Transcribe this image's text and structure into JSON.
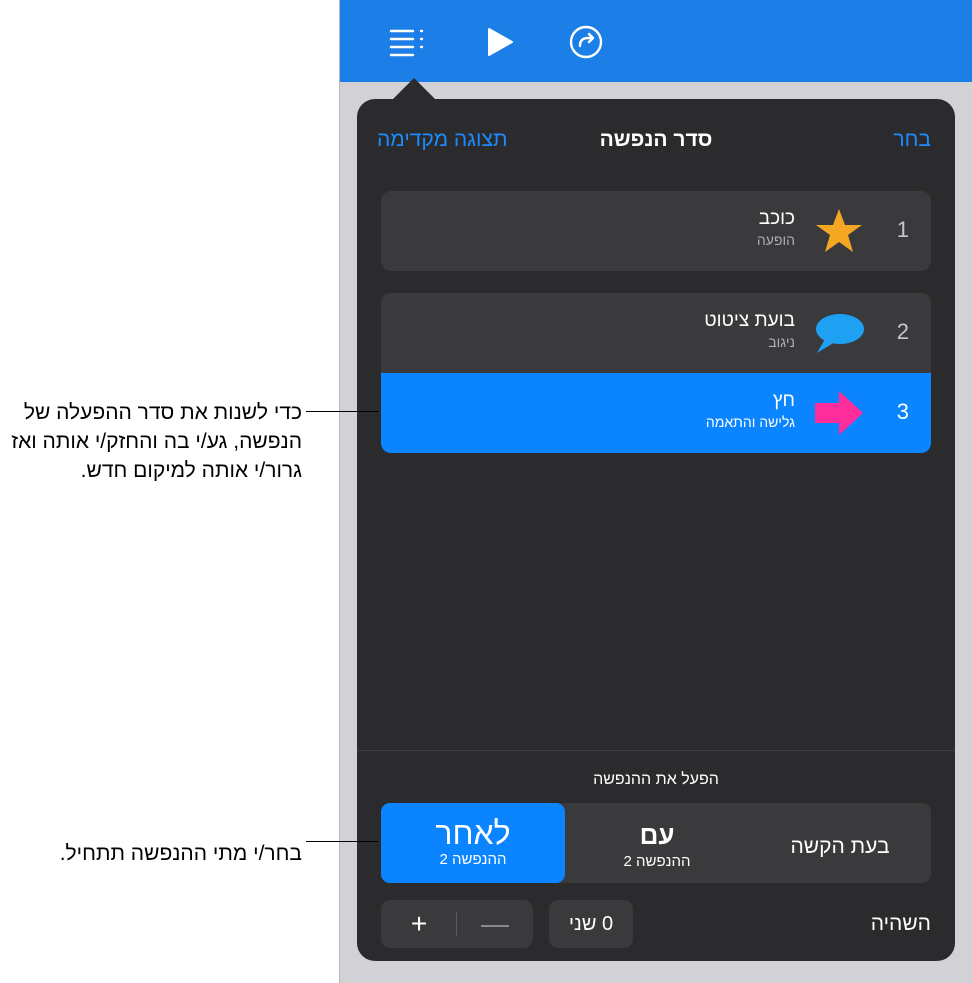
{
  "popover": {
    "title": "סדר הנפשה",
    "preview_label": "תצוגה מקדימה",
    "select_label": "בחר"
  },
  "animations": [
    {
      "number": "1",
      "name": "כוכב",
      "effect": "הופעה",
      "icon": "star-icon",
      "color": "#f5a623"
    },
    {
      "number": "2",
      "name": "בועת ציטוט",
      "effect": "ניגוב",
      "icon": "speech-bubble-icon",
      "color": "#1ea1f2"
    },
    {
      "number": "3",
      "name": "חץ",
      "effect": "גלישה והתאמה",
      "icon": "arrow-icon",
      "color": "#ff2d9b",
      "selected": true
    }
  ],
  "start": {
    "label": "הפעל את ההנפשה",
    "options": [
      {
        "main": "לאחר",
        "sub": "ההנפשה 2",
        "selected": true
      },
      {
        "main": "עם",
        "sub": "ההנפשה 2"
      },
      {
        "main": "בעת הקשה",
        "sub": ""
      }
    ]
  },
  "delay": {
    "label": "השהיה",
    "value": "0 שני",
    "plus": "+",
    "minus": "—"
  },
  "callouts": {
    "reorder": "כדי לשנות את סדר ההפעלה של הנפשה, גע/י בה והחזק/י אותה ואז גרור/י אותה למיקום חדש.",
    "start": "בחר/י מתי ההנפשה תתחיל."
  },
  "colors": {
    "toolbar": "#1c7fe8",
    "accent": "#0a84ff",
    "popover_bg": "#2b2b2d"
  }
}
